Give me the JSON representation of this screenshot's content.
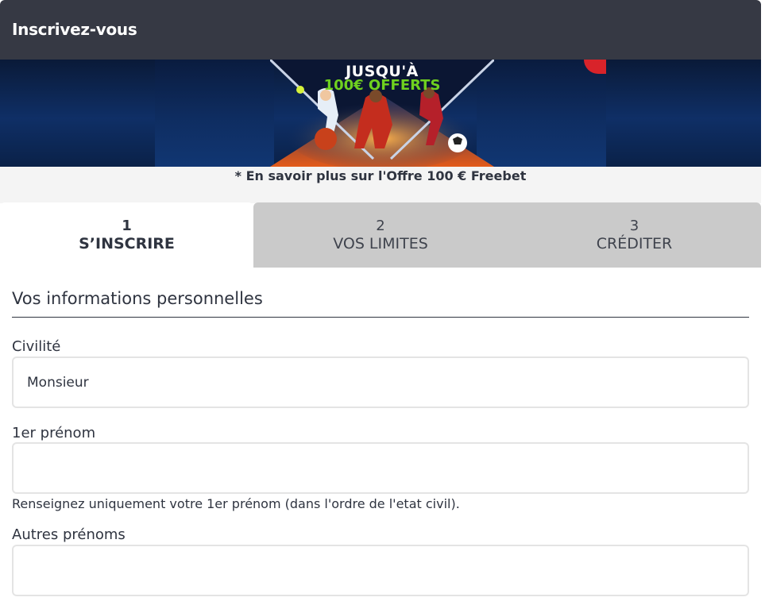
{
  "header": {
    "title": "Inscrivez-vous"
  },
  "banner": {
    "line1": "JUSQU'À",
    "line2": "100€ OFFERTS",
    "illustration": "sports-athletes-icon"
  },
  "promo": {
    "link_text": "* En savoir plus sur l'Offre 100 € Freebet"
  },
  "steps": [
    {
      "number": "1",
      "label": "S’INSCRIRE",
      "active": true
    },
    {
      "number": "2",
      "label": "VOS LIMITES",
      "active": false
    },
    {
      "number": "3",
      "label": "CRÉDITER",
      "active": false
    }
  ],
  "form": {
    "section_title": "Vos informations personnelles",
    "civilite": {
      "label": "Civilité",
      "value": "Monsieur"
    },
    "prenom": {
      "label": "1er prénom",
      "value": "",
      "help": "Renseignez uniquement votre 1er prénom (dans l'ordre de l'etat civil)."
    },
    "autres_prenoms": {
      "label": "Autres prénoms",
      "value": ""
    }
  },
  "colors": {
    "header_bg": "#363944",
    "step_inactive_bg": "#cacaca",
    "promo_green": "#6fd11f",
    "accent_red": "#d8232a"
  }
}
